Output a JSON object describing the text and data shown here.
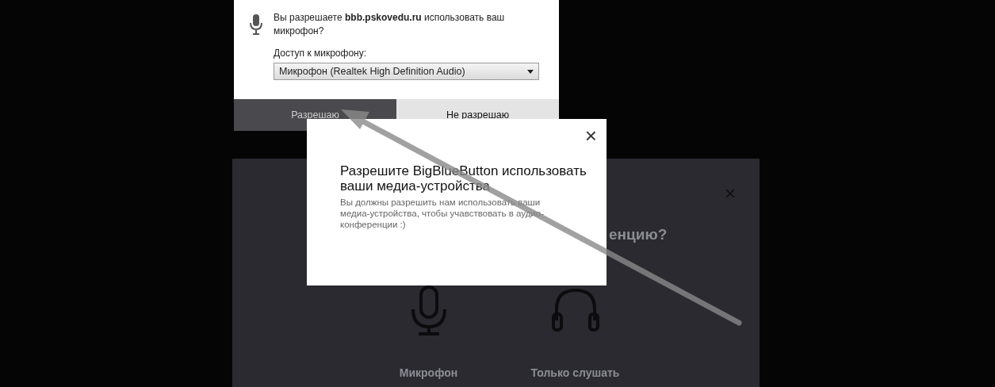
{
  "audio_modal": {
    "title_fragment": "енцию?",
    "options": [
      {
        "kind": "microphone",
        "label": "Микрофон"
      },
      {
        "kind": "listen",
        "label": "Только слушать"
      }
    ],
    "close": "×"
  },
  "permission_prompt": {
    "message": "Вы разрешаете **bbb.pskovedu.ru** использовать ваш микрофон?",
    "access_label": "Доступ к микрофону:",
    "device": "Микрофон (Realtek High Definition Audio)",
    "buttons": [
      {
        "label": "Разрешаю",
        "selected": true
      },
      {
        "label": "Не разрешаю",
        "selected": false
      }
    ]
  },
  "notification": {
    "close": "×",
    "title": "Разрешите BigBlueButton использовать ваши медиа-устройства",
    "body": "Вы должны разрешить нам использовать ваши медиа-устройства, чтобы учавствовать в аудио-конференции :)"
  }
}
